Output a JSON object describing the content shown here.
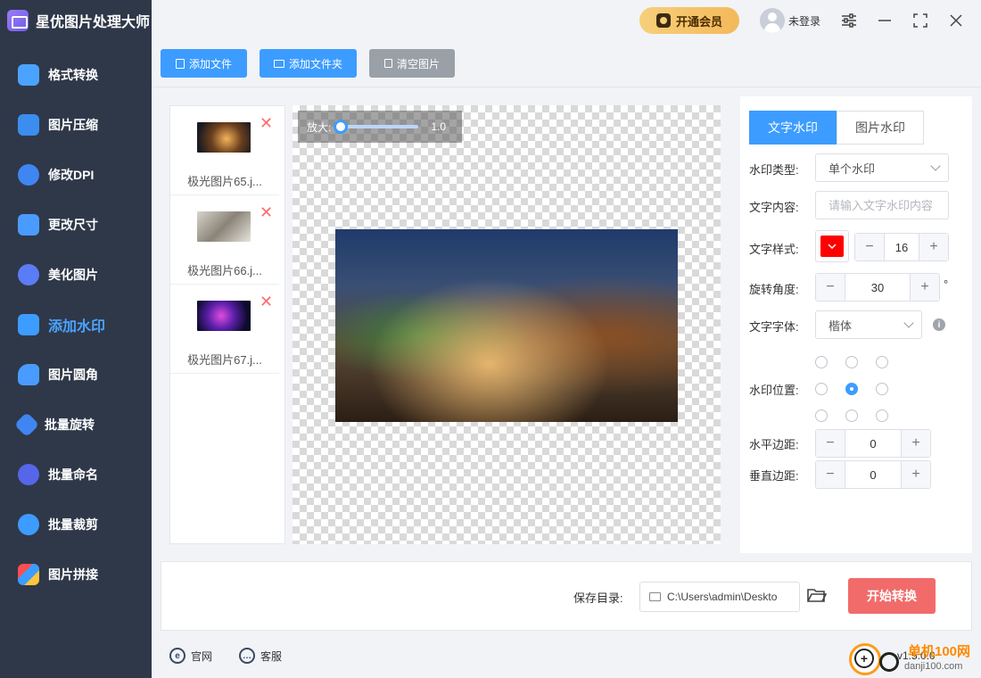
{
  "app": {
    "title": "星优图片处理大师"
  },
  "colors": {
    "accent": "#3d9cff",
    "start_button": "#f26b6b",
    "sidebar_bg": "#2f3849",
    "vip": "#f3b95b"
  },
  "header": {
    "vip_label": "开通会员",
    "user_label": "未登录"
  },
  "sidebar": {
    "items": [
      {
        "label": "格式转换",
        "icon": "format-convert-icon"
      },
      {
        "label": "图片压缩",
        "icon": "compress-icon"
      },
      {
        "label": "修改DPI",
        "icon": "dpi-icon"
      },
      {
        "label": "更改尺寸",
        "icon": "resize-icon"
      },
      {
        "label": "美化图片",
        "icon": "beautify-icon"
      },
      {
        "label": "添加水印",
        "icon": "watermark-icon",
        "active": true
      },
      {
        "label": "图片圆角",
        "icon": "round-corner-icon"
      },
      {
        "label": "批量旋转",
        "icon": "rotate-icon"
      },
      {
        "label": "批量命名",
        "icon": "rename-icon"
      },
      {
        "label": "批量裁剪",
        "icon": "crop-icon"
      },
      {
        "label": "图片拼接",
        "icon": "stitch-icon"
      }
    ]
  },
  "toolbar": {
    "add_file": "添加文件",
    "add_folder": "添加文件夹",
    "clear_images": "清空图片"
  },
  "files": [
    {
      "name": "极光图片65.j..."
    },
    {
      "name": "极光图片66.j..."
    },
    {
      "name": "极光图片67.j..."
    }
  ],
  "zoom": {
    "label": "放大:",
    "value": "1.0",
    "level": 0.05
  },
  "panel": {
    "tab_text": "文字水印",
    "tab_image": "图片水印",
    "type_label": "水印类型:",
    "type_value": "单个水印",
    "content_label": "文字内容:",
    "content_placeholder": "请输入文字水印内容",
    "style_label": "文字样式:",
    "font_size": "16",
    "text_color": "#ff0000",
    "rotate_label": "旋转角度:",
    "rotate_value": "30",
    "degree": "°",
    "font_label": "文字字体:",
    "font_value": "楷体",
    "position_label": "水印位置:",
    "position_selected": "center",
    "h_margin_label": "水平边距:",
    "h_margin": "0",
    "v_margin_label": "垂直边距:",
    "v_margin": "0"
  },
  "bottom": {
    "save_label": "保存目录:",
    "save_path": "C:\\Users\\admin\\Deskto",
    "start_label": "开始转换"
  },
  "footer": {
    "website": "官网",
    "support": "客服",
    "version": "v1.5.0.0"
  },
  "site_watermark": {
    "name": "单机100网",
    "url": "danji100.com"
  }
}
